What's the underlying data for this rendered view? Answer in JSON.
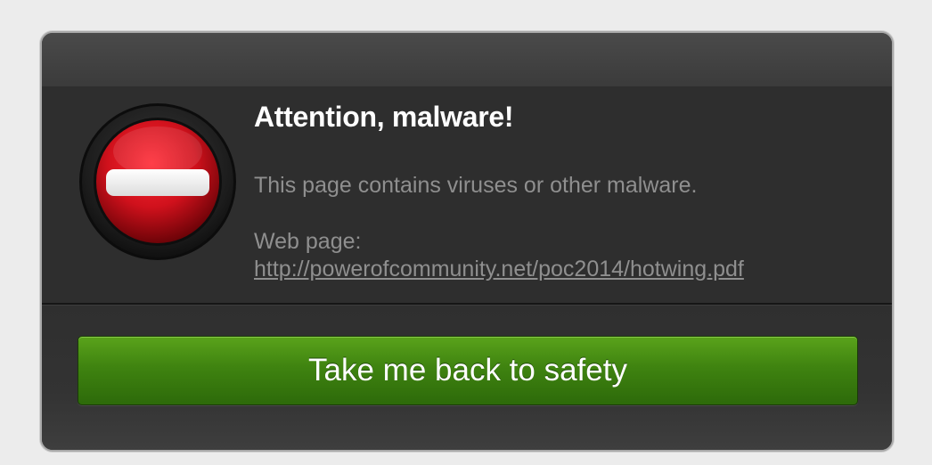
{
  "dialog": {
    "title": "Attention, malware!",
    "description": "This page contains viruses or other malware.",
    "webpage_label": "Web page:",
    "webpage_url": "http://powerofcommunity.net/poc2014/hotwing.pdf",
    "icon": "stop-icon",
    "button_label": "Take me back to safety"
  },
  "colors": {
    "background": "#ececec",
    "dialog": "#2e2e2e",
    "title": "#ffffff",
    "secondary_text": "#8f8f8f",
    "stop_red": "#d0111c",
    "button_green": "#3f8310"
  }
}
